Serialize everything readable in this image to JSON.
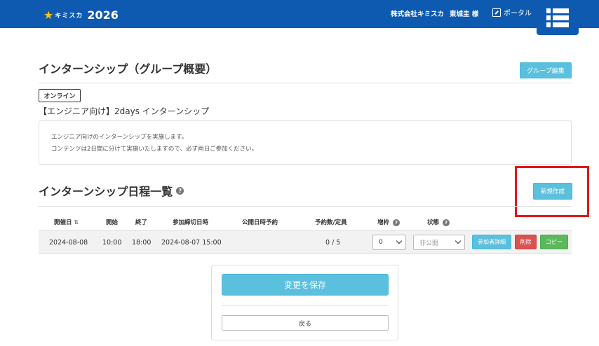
{
  "header": {
    "logo_brand": "キミスカ",
    "logo_year": "2026",
    "company": "株式会社キミスカ",
    "user": "東城圭 様",
    "portal": "ポータル"
  },
  "group": {
    "title": "インターンシップ（グループ概要）",
    "edit_button": "グループ編集",
    "badge": "オンライン",
    "name": "【エンジニア向け】2days インターンシップ",
    "description_line1": "エンジニア向けのインターンシップを実施します。",
    "description_line2": "コンテンツは2日間に分けて実施いたしますので、必ず両日ご参加ください。"
  },
  "schedule": {
    "title": "インターンシップ日程一覧",
    "new_button": "新規作成",
    "columns": {
      "date": "開催日",
      "start": "開始",
      "end": "終了",
      "deadline": "参加締切日時",
      "public_reservation": "公開日時予約",
      "capacity": "予約数/定員",
      "increase": "増枠",
      "status": "状態"
    },
    "rows": [
      {
        "date": "2024-08-08",
        "start": "10:00",
        "end": "18:00",
        "deadline": "2024-08-07 15:00",
        "public_reservation": "",
        "capacity": "0 / 5",
        "increase": "0",
        "status": "非公開",
        "detail_button": "参加者詳細",
        "delete_button": "削除",
        "copy_button": "コピー"
      }
    ]
  },
  "actions": {
    "save": "変更を保存",
    "back": "戻る"
  },
  "colors": {
    "header": "#0d5ab0",
    "info": "#5bc0de",
    "danger": "#d9534f",
    "success": "#5cb85c",
    "highlight": "#e0181b"
  }
}
